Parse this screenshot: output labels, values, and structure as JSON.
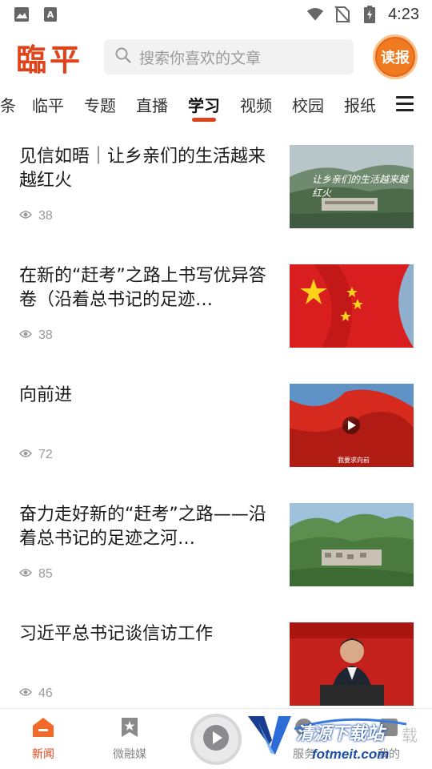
{
  "status_bar": {
    "time": "4:23",
    "icons": [
      "image-icon",
      "a-notification-icon",
      "wifi-icon",
      "no-sim-icon",
      "battery-charging-icon"
    ]
  },
  "header": {
    "logo": "臨平",
    "search_placeholder": "搜索你喜欢的文章",
    "read_badge": "读报"
  },
  "tabs": [
    {
      "label": "条"
    },
    {
      "label": "临平"
    },
    {
      "label": "专题"
    },
    {
      "label": "直播"
    },
    {
      "label": "学习",
      "active": true
    },
    {
      "label": "视频"
    },
    {
      "label": "校园"
    },
    {
      "label": "报纸"
    }
  ],
  "articles": [
    {
      "title": "见信如晤｜让乡亲们的生活越来越红火",
      "views": "38",
      "thumb": "village-landscape",
      "thumb_caption": "让乡亲们的生活越来越红火"
    },
    {
      "title": "在新的“赶考”之路上书写优异答卷（沿着总书记的足迹…",
      "views": "38",
      "thumb": "national-flag"
    },
    {
      "title": "向前进",
      "views": "72",
      "thumb": "flag-video",
      "thumb_caption": "我要求向前"
    },
    {
      "title": "奋力走好新的“赶考”之路——沿着总书记的足迹之河…",
      "views": "85",
      "thumb": "mountain-village"
    },
    {
      "title": "习近平总书记谈信访工作",
      "views": "46",
      "thumb": "speaker-photo"
    }
  ],
  "bottom_nav": [
    {
      "label": "新闻",
      "icon": "home-icon",
      "active": true
    },
    {
      "label": "微融媒",
      "icon": "bookmark-star-icon"
    },
    {
      "label": "",
      "icon": "play-icon"
    },
    {
      "label": "服务",
      "icon": "service-icon"
    },
    {
      "label": "我的",
      "icon": "profile-icon"
    }
  ],
  "watermark": {
    "text": "清源下载站",
    "url": "fotmeit.com",
    "suffix": "载"
  },
  "colors": {
    "accent": "#e0431a",
    "badge": "#f07a1f"
  }
}
